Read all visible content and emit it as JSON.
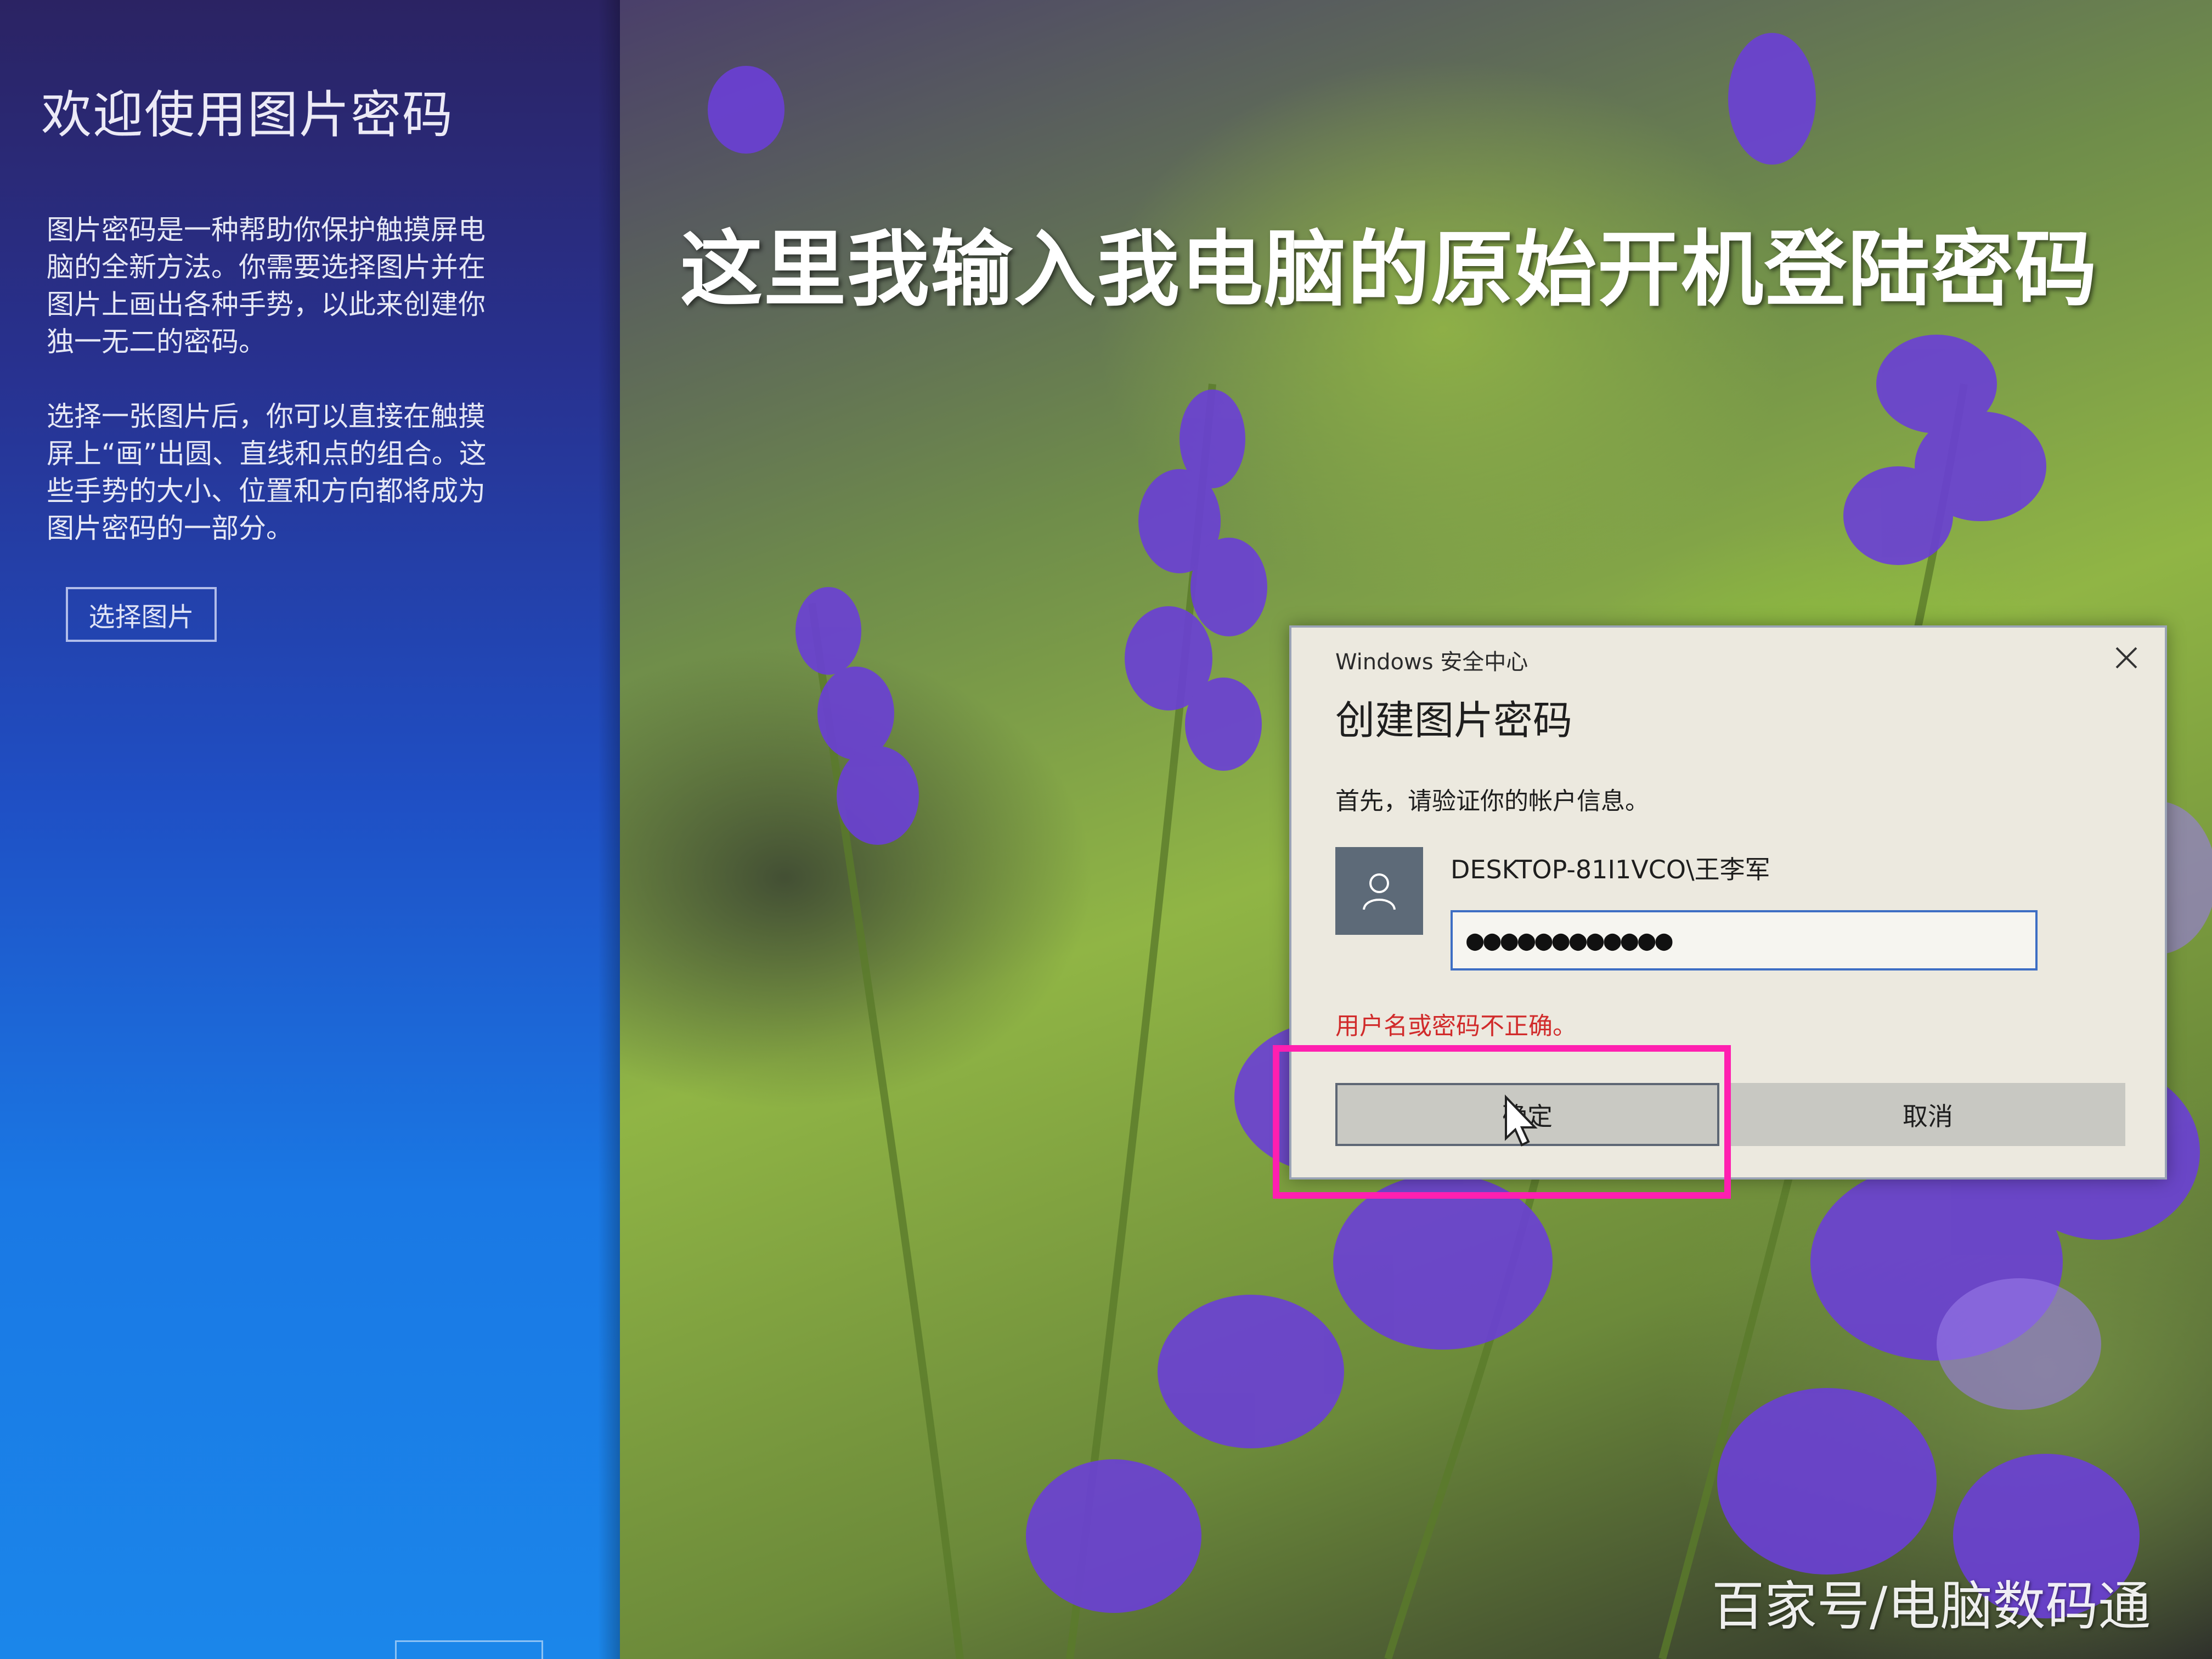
{
  "left_panel": {
    "title": "欢迎使用图片密码",
    "paragraph1": "图片密码是一种帮助你保护触摸屏电脑的全新方法。你需要选择图片并在图片上画出各种手势，以此来创建你独一无二的密码。",
    "paragraph2": "选择一张图片后，你可以直接在触摸屏上“画”出圆、直线和点的组合。这些手势的大小、位置和方向都将成为图片密码的一部分。",
    "choose_picture_button": "选择图片"
  },
  "overlay": {
    "caption": "这里我输入我电脑的原始开机登陆密码",
    "watermark": "百家号/电脑数码通",
    "highlight_color": "#ff1fb0"
  },
  "dialog": {
    "app_name": "Windows 安全中心",
    "title": "创建图片密码",
    "instruction": "首先，请验证你的帐户信息。",
    "account_name": "DESKTOP-81I1VCO\\王李军",
    "password_value": "●●●●●●●●●●●●",
    "error_message": "用户名或密码不正确。",
    "ok_button": "确定",
    "cancel_button": "取消",
    "close_icon": "close-icon",
    "avatar_icon": "user-icon",
    "error_color": "#d12b2b"
  }
}
